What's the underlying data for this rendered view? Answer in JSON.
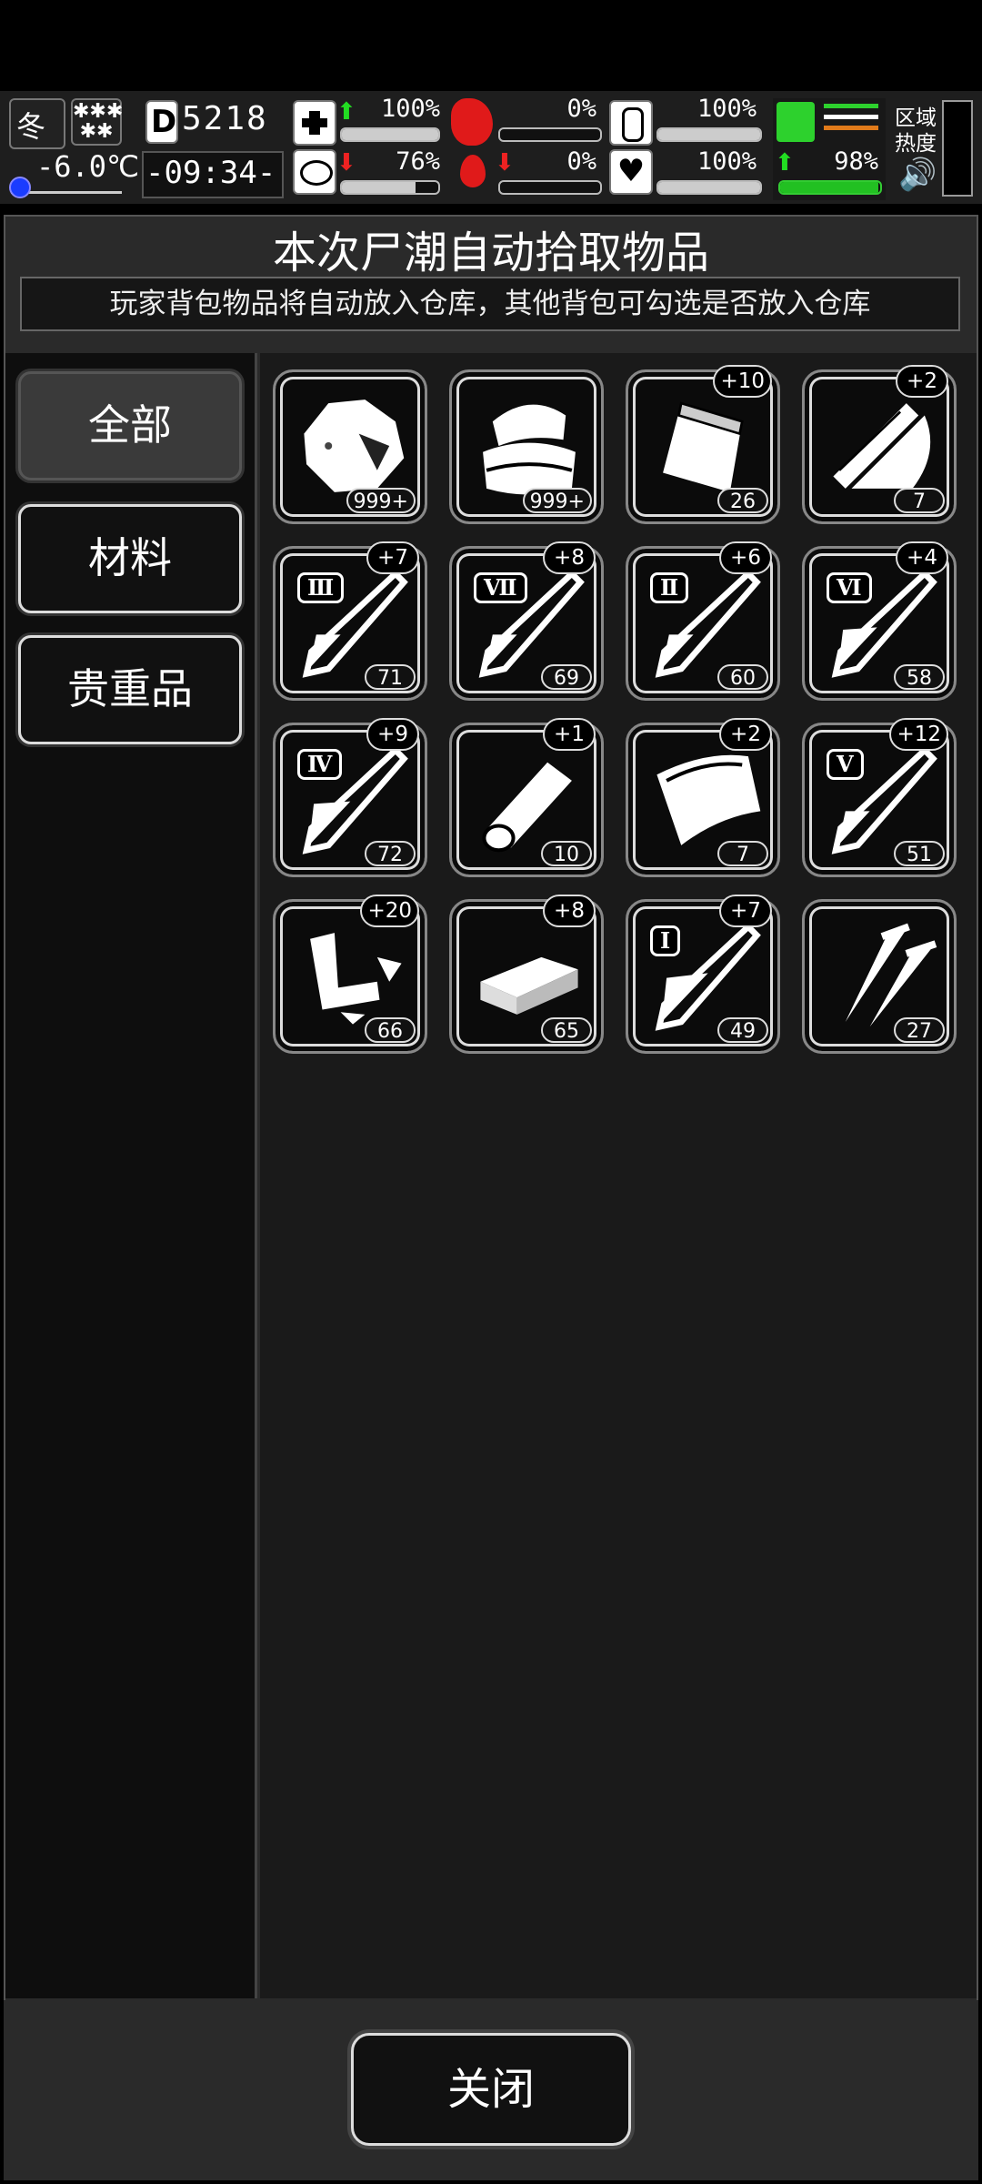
{
  "hud": {
    "season": "冬",
    "temperature": "-6.0℃",
    "day": "5218",
    "day_prefix": "D",
    "clock": "-09:34-",
    "stats": {
      "health": "100%",
      "stomach": "0%",
      "stamina_bottle": "100%",
      "sanity": "76%",
      "blood": "0%",
      "heart": "100%",
      "leg": "98%"
    },
    "zone_heat_label": "区域热度"
  },
  "dialog": {
    "title": "本次尸潮自动拾取物品",
    "subtitle": "玩家背包物品将自动放入仓库，其他背包可勾选是否放入仓库"
  },
  "tabs": [
    {
      "label": "全部",
      "active": true
    },
    {
      "label": "材料",
      "active": false
    },
    {
      "label": "贵重品",
      "active": false
    }
  ],
  "items": [
    {
      "icon": "ore-rock-icon",
      "count": "999+",
      "bonus": ""
    },
    {
      "icon": "cloth-pile-icon",
      "count": "999+",
      "bonus": ""
    },
    {
      "icon": "plastic-bag-icon",
      "count": "26",
      "bonus": "+10"
    },
    {
      "icon": "wood-planks-icon",
      "count": "7",
      "bonus": "+2"
    },
    {
      "icon": "syringe-icon",
      "roman": "Ⅲ",
      "count": "71",
      "bonus": "+7"
    },
    {
      "icon": "syringe-icon",
      "roman": "Ⅶ",
      "count": "69",
      "bonus": "+8"
    },
    {
      "icon": "syringe-icon",
      "roman": "Ⅱ",
      "count": "60",
      "bonus": "+6"
    },
    {
      "icon": "syringe-icon",
      "roman": "Ⅵ",
      "count": "58",
      "bonus": "+4"
    },
    {
      "icon": "syringe-icon",
      "roman": "Ⅳ",
      "count": "72",
      "bonus": "+9"
    },
    {
      "icon": "bandage-roll-icon",
      "count": "10",
      "bonus": "+1"
    },
    {
      "icon": "leather-sheet-icon",
      "count": "7",
      "bonus": "+2"
    },
    {
      "icon": "syringe-icon",
      "roman": "Ⅴ",
      "count": "51",
      "bonus": "+12"
    },
    {
      "icon": "scrap-metal-icon",
      "count": "66",
      "bonus": "+20"
    },
    {
      "icon": "brick-icon",
      "count": "65",
      "bonus": "+8"
    },
    {
      "icon": "syringe-icon",
      "roman": "Ⅰ",
      "count": "49",
      "bonus": "+7"
    },
    {
      "icon": "nails-icon",
      "count": "27",
      "bonus": ""
    }
  ],
  "footer": {
    "close_label": "关闭"
  }
}
